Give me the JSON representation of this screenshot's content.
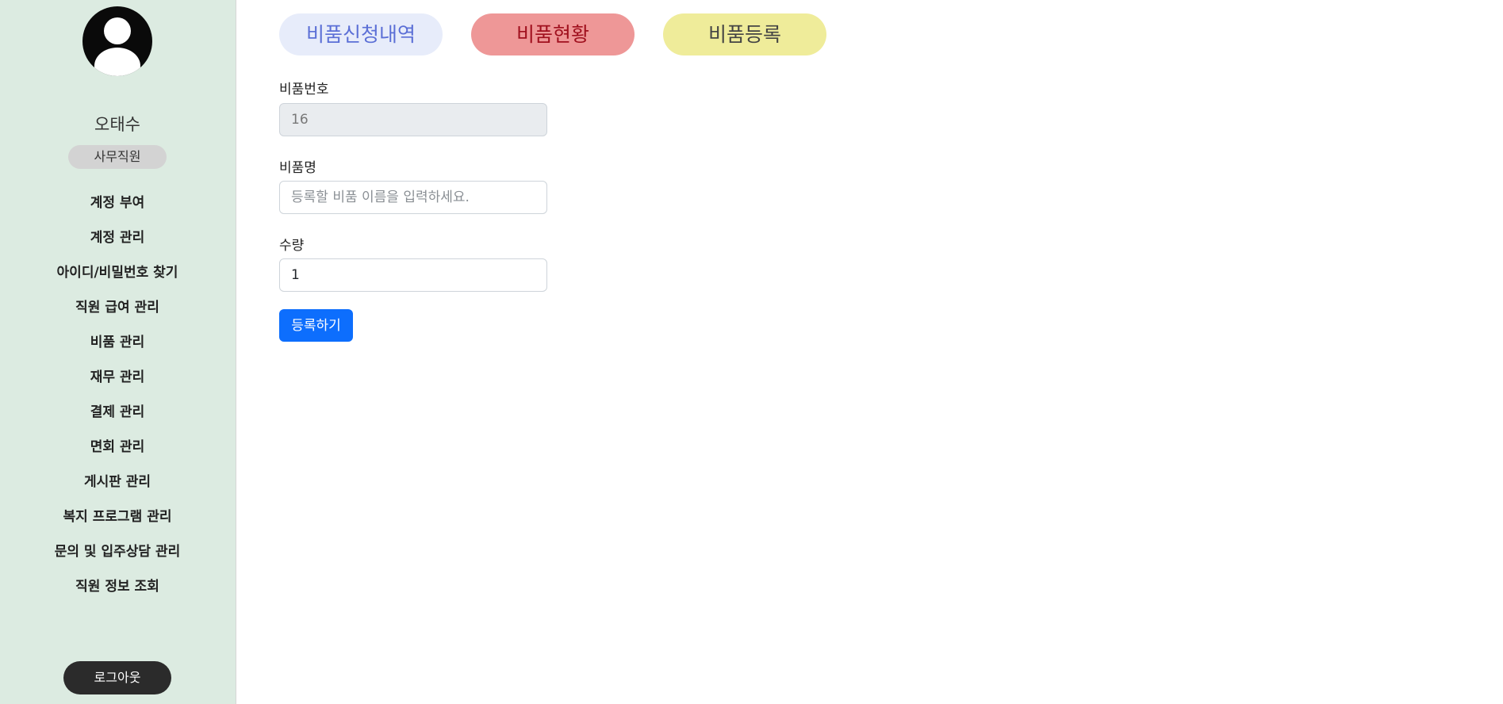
{
  "sidebar": {
    "user_name": "오태수",
    "role": "사무직원",
    "menu": [
      "계정 부여",
      "계정 관리",
      "아이디/비밀번호 찾기",
      "직원 급여 관리",
      "비품 관리",
      "재무 관리",
      "결제 관리",
      "면회 관리",
      "게시판 관리",
      "복지 프로그램 관리",
      "문의 및 입주상담 관리",
      "직원 정보 조회"
    ],
    "logout_label": "로그아웃"
  },
  "tabs": {
    "requests": "비품신청내역",
    "status": "비품현황",
    "register": "비품등록"
  },
  "form": {
    "item_number_label": "비품번호",
    "item_number_value": "16",
    "item_name_label": "비품명",
    "item_name_placeholder": "등록할 비품 이름을 입력하세요.",
    "quantity_label": "수량",
    "quantity_value": "1",
    "submit_label": "등록하기"
  },
  "colors": {
    "sidebar_bg": "#dcebe1",
    "primary": "#0d6efd",
    "tab_requests": "#e7ecfa",
    "tab_status": "#ee9797",
    "tab_register": "#efec9a"
  }
}
